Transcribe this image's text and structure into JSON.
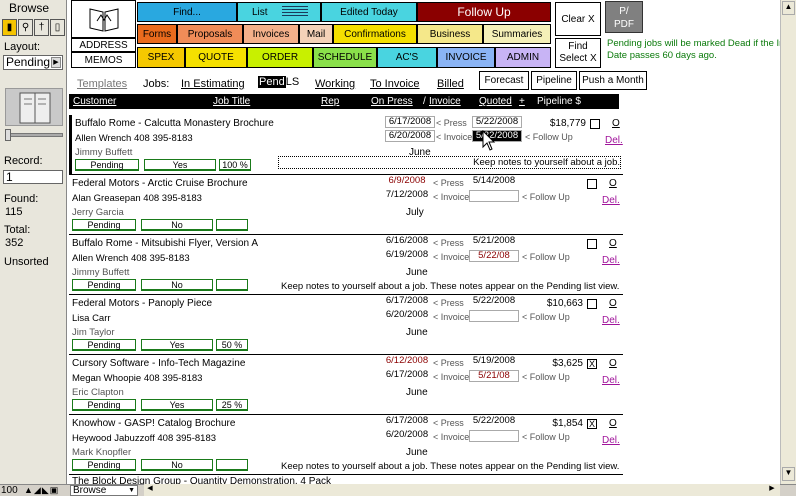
{
  "left_panel": {
    "mode_title": "Browse",
    "layout_label": "Layout:",
    "layout_value": "Pending",
    "record_label": "Record:",
    "record_value": "1",
    "found_label": "Found:",
    "found_value": "115",
    "total_label": "Total:",
    "total_value": "352",
    "sort_status": "Unsorted"
  },
  "bottom_bar": {
    "zoom": "100",
    "mode": "Browse"
  },
  "nav": {
    "address": "ADDRESS",
    "memos": "MEMOS",
    "row1": [
      "Find...",
      "List",
      "Edited Today",
      "Follow Up"
    ],
    "row2": [
      "Forms",
      "Proposals",
      "Invoices",
      "Mail",
      "Confirmations",
      "Business",
      "Summaries"
    ],
    "row3": [
      "SPEX",
      "QUOTE",
      "ORDER",
      "SCHEDULE",
      "AC'S",
      "INVOICE",
      "ADMIN"
    ],
    "clear_x": "Clear X",
    "find_select_x_1": "Find",
    "find_select_x_2": "Select X",
    "pdf_1": "P/",
    "pdf_2": "PDF",
    "notice_1": "Pending jobs will be marked Dead if the Ir",
    "notice_2": "Date passes 60 days ago.",
    "colors": {
      "find": "#29a8e0",
      "list": "#49d4e0",
      "edited": "#49d4e0",
      "followup": "#8b0000",
      "forms": "#ea6b1d",
      "proposals": "#f08c58",
      "invoices": "#f4b08a",
      "mail": "#f4d2b8",
      "confirmations": "#f5e000",
      "business": "#f5e88a",
      "summaries": "#f5f0b8",
      "spex": "#f5c800",
      "quote": "#f5e000",
      "order": "#c8f000",
      "schedule": "#8ae04a",
      "acs": "#49d4e0",
      "invoice": "#8ab4f5",
      "admin": "#c8b4f5"
    }
  },
  "jobs_bar": {
    "templates": "Templates",
    "jobs": "Jobs:",
    "estimating": "In Estimating",
    "pending": "Pend",
    "pending_suffix": "LS",
    "working": "Working",
    "to_invoice": "To Invoice",
    "billed": "Billed",
    "forecast": "Forecast",
    "pipeline": "Pipeline",
    "push_month": "Push a Month"
  },
  "columns": {
    "customer": "Customer",
    "job_title": "Job Title",
    "rep": "Rep",
    "on_press": "On Press",
    "invoice": "Invoice",
    "quoted": "Quoted",
    "plus": "+",
    "pipeline": "Pipeline $"
  },
  "labels": {
    "press": "< Press",
    "invoice": "< Invoice",
    "follow_up": "< Follow Up",
    "o": "O",
    "del": "Del."
  },
  "rows": [
    {
      "title": "Buffalo Rome  -  Calcutta Monastery Brochure",
      "contact": "Allen Wrench  408 395-8183",
      "rep": "Jimmy Buffett",
      "press": "6/17/2008",
      "invoice": "6/20/2008",
      "month": "June",
      "quoted": "5/22/2008",
      "followup": "5/22/2008",
      "amount": "$18,779",
      "status": "Pending",
      "yes": "Yes",
      "pct": "100 %",
      "note": "Keep notes to yourself about a job.",
      "checked": ""
    },
    {
      "title": "Federal Motors  -  Arctic Cruise Brochure",
      "contact": "Alan Greasepan  408 395-8183",
      "rep": "Jerry Garcia",
      "press": "6/9/2008",
      "invoice": "7/12/2008",
      "month": "July",
      "quoted": "5/14/2008",
      "followup": "",
      "amount": "",
      "status": "Pending",
      "yes": "No",
      "pct": "",
      "note": "",
      "checked": ""
    },
    {
      "title": "Buffalo Rome  -  Mitsubishi Flyer, Version A",
      "contact": "Allen Wrench  408 395-8183",
      "rep": "Jimmy Buffett",
      "press": "6/16/2008",
      "invoice": "6/19/2008",
      "month": "June",
      "quoted": "5/21/2008",
      "followup": "5/22/08",
      "amount": "",
      "status": "Pending",
      "yes": "No",
      "pct": "",
      "note": "Keep notes to yourself about a job.  These notes appear on the Pending list view.",
      "checked": ""
    },
    {
      "title": "Federal Motors  -  Panoply Piece",
      "contact": "Lisa Carr",
      "rep": "Jim Taylor",
      "press": "6/17/2008",
      "invoice": "6/20/2008",
      "month": "June",
      "quoted": "5/22/2008",
      "followup": "",
      "amount": "$10,663",
      "status": "Pending",
      "yes": "Yes",
      "pct": "50 %",
      "note": "",
      "checked": ""
    },
    {
      "title": "Cursory Software  -  Info-Tech Magazine",
      "contact": "Megan Whoopie  408 395-8183",
      "rep": "Eric Clapton",
      "press": "6/12/2008",
      "invoice": "6/17/2008",
      "month": "June",
      "quoted": "5/19/2008",
      "followup": "5/21/08",
      "amount": "$3,625",
      "status": "Pending",
      "yes": "Yes",
      "pct": "25 %",
      "note": "",
      "checked": "X"
    },
    {
      "title": "Knowhow  -  GASP! Catalog Brochure",
      "contact": "Heywood Jabuzzoff  408 395-8183",
      "rep": "Mark Knopfler",
      "press": "6/17/2008",
      "invoice": "6/20/2008",
      "month": "June",
      "quoted": "5/22/2008",
      "followup": "",
      "amount": "$1,854",
      "status": "Pending",
      "yes": "No",
      "pct": "",
      "note": "Keep notes to yourself about a job.  These notes appear on the Pending list view.",
      "checked": "X"
    }
  ],
  "partial_row": "The Block Design Group  -  Quantity Demonstration, 4 Pack"
}
